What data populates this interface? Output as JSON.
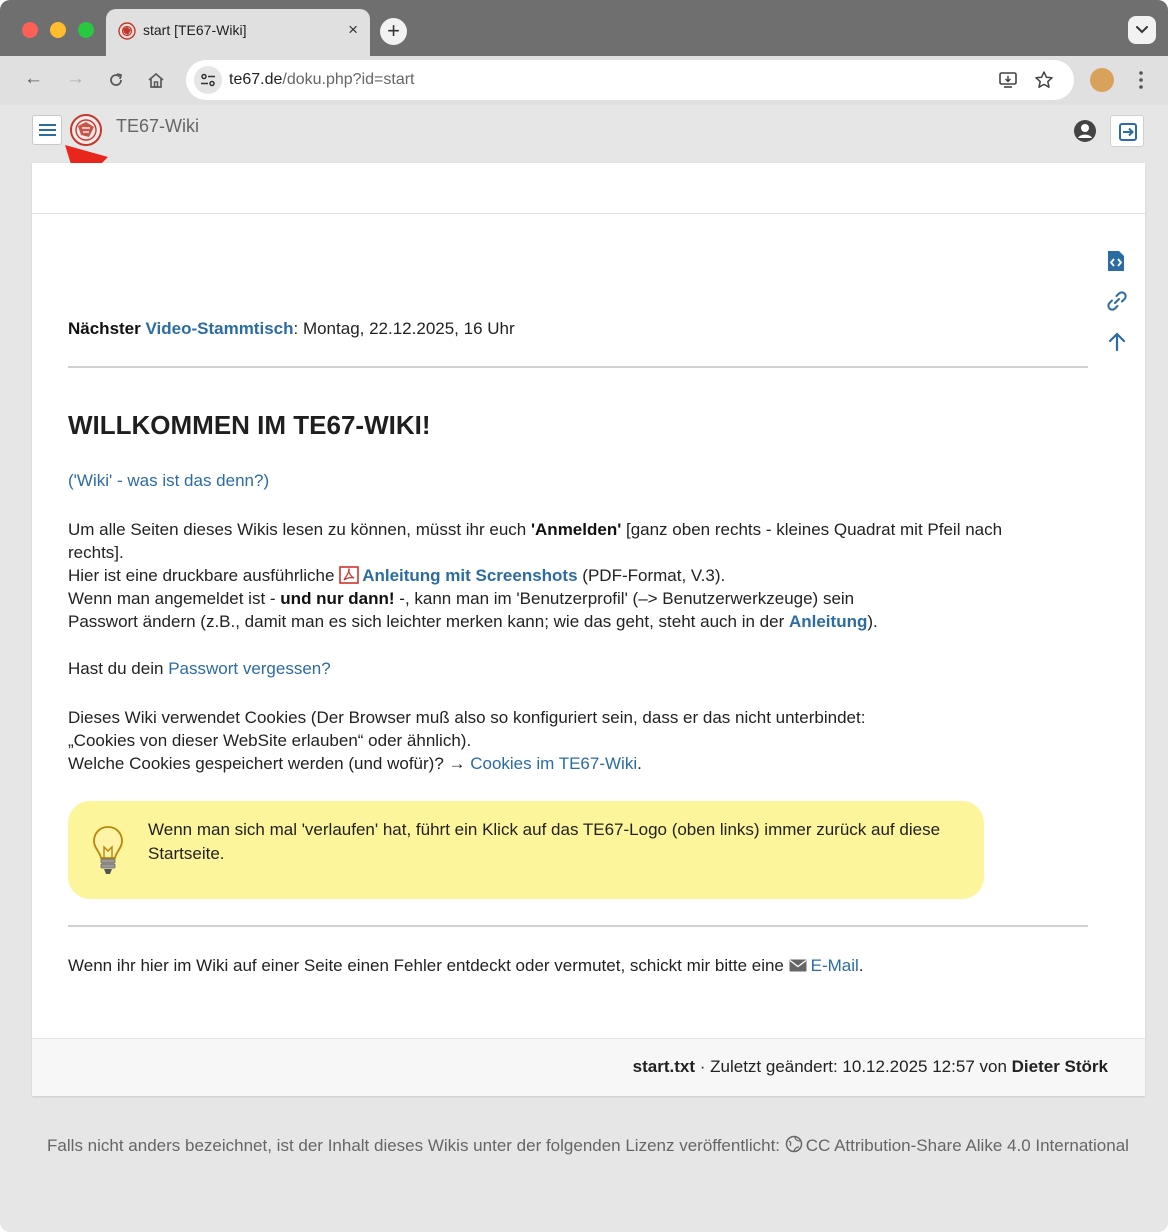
{
  "browser": {
    "tab_title": "start [TE67-Wiki]",
    "tab_close": "×",
    "new_tab": "+",
    "url_domain": "te67.de",
    "url_path": "/doku.php?id=start"
  },
  "header": {
    "site_title": "TE67-Wiki"
  },
  "announcement": {
    "prefix": "Nächster ",
    "link": "Video-Stammtisch",
    "suffix": ": Montag, 22.12.2025, 16 Uhr"
  },
  "heading": "WILLKOMMEN IM TE67-WIKI!",
  "wiki_link": "('Wiki' - was ist das denn?)",
  "intro": {
    "l1_a": "Um alle Seiten dieses Wikis lesen zu können, müsst ihr euch ",
    "l1_bold": "'Anmelden'",
    "l1_b": " [ganz oben rechts - kleines Quadrat mit Pfeil nach",
    "l1_c": "rechts].",
    "l2_a": "Hier ist eine druckbare ausführliche ",
    "l2_link": "Anleitung mit Screenshots",
    "l2_b": " (PDF-Format, V.3).",
    "l3_a": "Wenn man angemeldet ist - ",
    "l3_bold": "und nur dann!",
    "l3_b": " -, kann man im 'Benutzerprofil' (–> Benutzerwerkzeuge) sein",
    "l4_a": "Passwort ändern (z.B., damit man es sich leichter merken kann; wie das geht, steht auch in der ",
    "l4_link": "Anleitung",
    "l4_b": ")."
  },
  "password": {
    "prefix": "Hast du dein ",
    "link": "Passwort vergessen?"
  },
  "cookies": {
    "l1": "Dieses Wiki verwendet Cookies (Der Browser muß also so konfiguriert sein, dass er das nicht unterbindet:",
    "l2": "„Cookies von dieser WebSite erlauben“ oder ähnlich).",
    "l3_a": "Welche Cookies gespeichert werden (und wofür)? → ",
    "l3_link": "Cookies im TE67-Wiki",
    "l3_b": "."
  },
  "tip": "Wenn man sich mal 'verlaufen' hat, führt ein Klick auf das TE67-Logo (oben links) immer zurück auf diese Startseite.",
  "error_report": {
    "prefix": "Wenn ihr hier im Wiki auf einer Seite einen Fehler entdeckt oder vermutet, schickt mir bitte eine ",
    "link": "E-Mail",
    "suffix": "."
  },
  "page_footer": {
    "filename": "start.txt",
    "changed": " · Zuletzt geändert: 10.12.2025 12:57 von ",
    "author": "Dieter Störk"
  },
  "license": {
    "prefix": "Falls nicht anders bezeichnet, ist der Inhalt dieses Wikis unter der folgenden Lizenz veröffentlicht: ",
    "link": "CC Attribution-Share Alike 4.0 International"
  },
  "colors": {
    "link": "#2b6ca3",
    "tip_background": "#fdf59b",
    "annotation_arrow": "#e8261c"
  }
}
